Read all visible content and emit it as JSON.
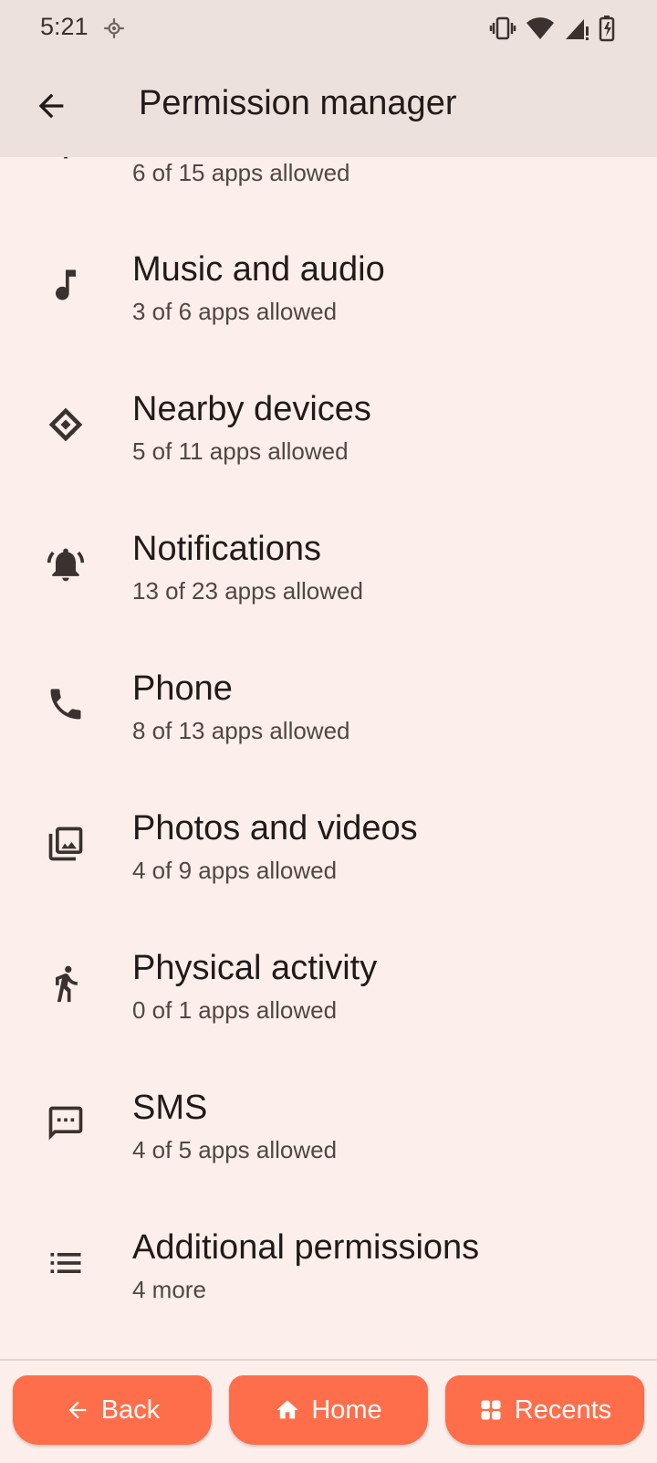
{
  "status_bar": {
    "time": "5:21",
    "icons": [
      "location-icon",
      "vibrate-icon",
      "wifi-icon",
      "signal-icon",
      "battery-charging-icon"
    ]
  },
  "app_bar": {
    "back_icon": "arrow-back-icon",
    "title": "Permission manager"
  },
  "permissions": [
    {
      "label": "",
      "summary": "6 of 15 apps allowed",
      "icon": "partial-icon"
    },
    {
      "label": "Music and audio",
      "summary": "3 of 6 apps allowed",
      "icon": "music-note-icon"
    },
    {
      "label": "Nearby devices",
      "summary": "5 of 11 apps allowed",
      "icon": "nearby-devices-icon"
    },
    {
      "label": "Notifications",
      "summary": "13 of 23 apps allowed",
      "icon": "notifications-icon"
    },
    {
      "label": "Phone",
      "summary": "8 of 13 apps allowed",
      "icon": "phone-icon"
    },
    {
      "label": "Photos and videos",
      "summary": "4 of 9 apps allowed",
      "icon": "photos-icon"
    },
    {
      "label": "Physical activity",
      "summary": "0 of 1 apps allowed",
      "icon": "running-person-icon"
    },
    {
      "label": "SMS",
      "summary": "4 of 5 apps allowed",
      "icon": "sms-icon"
    },
    {
      "label": "Additional permissions",
      "summary": "4 more",
      "icon": "list-icon"
    }
  ],
  "nav_bar": {
    "back_label": "Back",
    "home_label": "Home",
    "recents_label": "Recents",
    "accent_color": "#ff6e4a"
  },
  "colors": {
    "background": "#fcefeb",
    "app_bar": "#ede1dd"
  }
}
